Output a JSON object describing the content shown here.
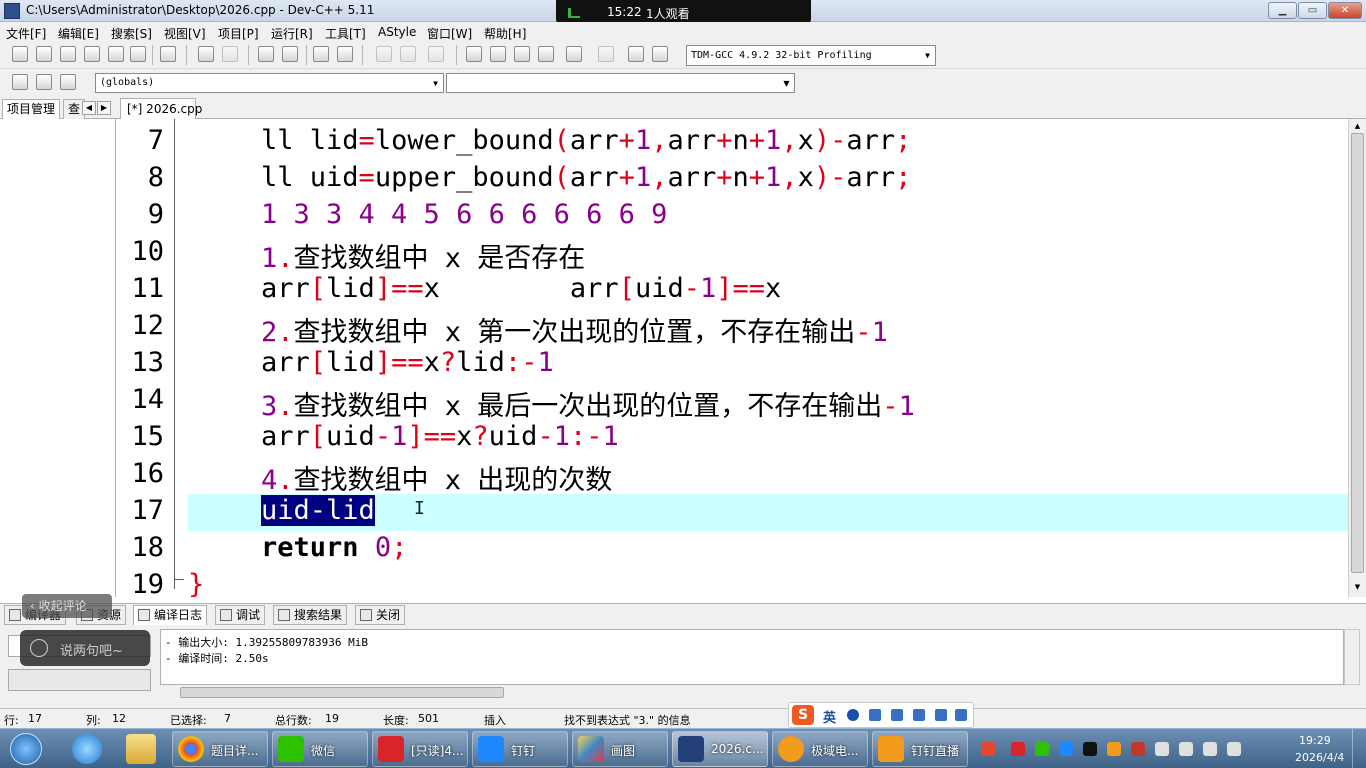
{
  "window": {
    "title": "C:\\Users\\Administrator\\Desktop\\2026.cpp - Dev-C++ 5.11"
  },
  "live": {
    "time": "15:22",
    "viewers": "1人观看"
  },
  "menu": [
    "文件[F]",
    "编辑[E]",
    "搜索[S]",
    "视图[V]",
    "项目[P]",
    "运行[R]",
    "工具[T]",
    "AStyle",
    "窗口[W]",
    "帮助[H]"
  ],
  "toolbar": {
    "compiler": "TDM-GCC 4.9.2 32-bit Profiling",
    "scope": "(globals)",
    "function": ""
  },
  "left_panel": {
    "tabs": [
      "项目管理",
      "查"
    ]
  },
  "editor": {
    "file_tab": "[*] 2026.cpp",
    "line_numbers": [
      "7",
      "8",
      "9",
      "10",
      "11",
      "12",
      "13",
      "14",
      "15",
      "16",
      "17",
      "18",
      "19"
    ],
    "current_line": 17,
    "selection": "uid-lid"
  },
  "bottom": {
    "tabs": [
      "编译器",
      "资源",
      "编译日志",
      "调试",
      "搜索结果",
      "关闭"
    ],
    "log": [
      "- 输出大小: 1.39255809783936 MiB",
      "- 编译时间: 2.50s"
    ]
  },
  "overlay": {
    "collapse_comments": "收起评论",
    "chat_placeholder": "说两句吧~"
  },
  "status": {
    "row_label": "行:",
    "row": "17",
    "col_label": "列:",
    "col": "12",
    "selected_label": "已选择:",
    "selected": "7",
    "total_label": "总行数:",
    "total": "19",
    "length_label": "长度:",
    "length": "501",
    "mode": "插入",
    "message": "找不到表达式 \"3.\" 的信息"
  },
  "ime": {
    "logo": "S",
    "lang": "英"
  },
  "taskbar": {
    "tasks": [
      "题目详...",
      "微信",
      "[只读]4...",
      "钉钉",
      "画图",
      "2026.c...",
      "极域电...",
      "钉钉直播"
    ],
    "time": "19:29",
    "date": "2026/4/4"
  },
  "colors": {
    "operator": "#e0001b",
    "number": "#8a008a",
    "current_line": "#ccffff",
    "selection": "#000080"
  }
}
